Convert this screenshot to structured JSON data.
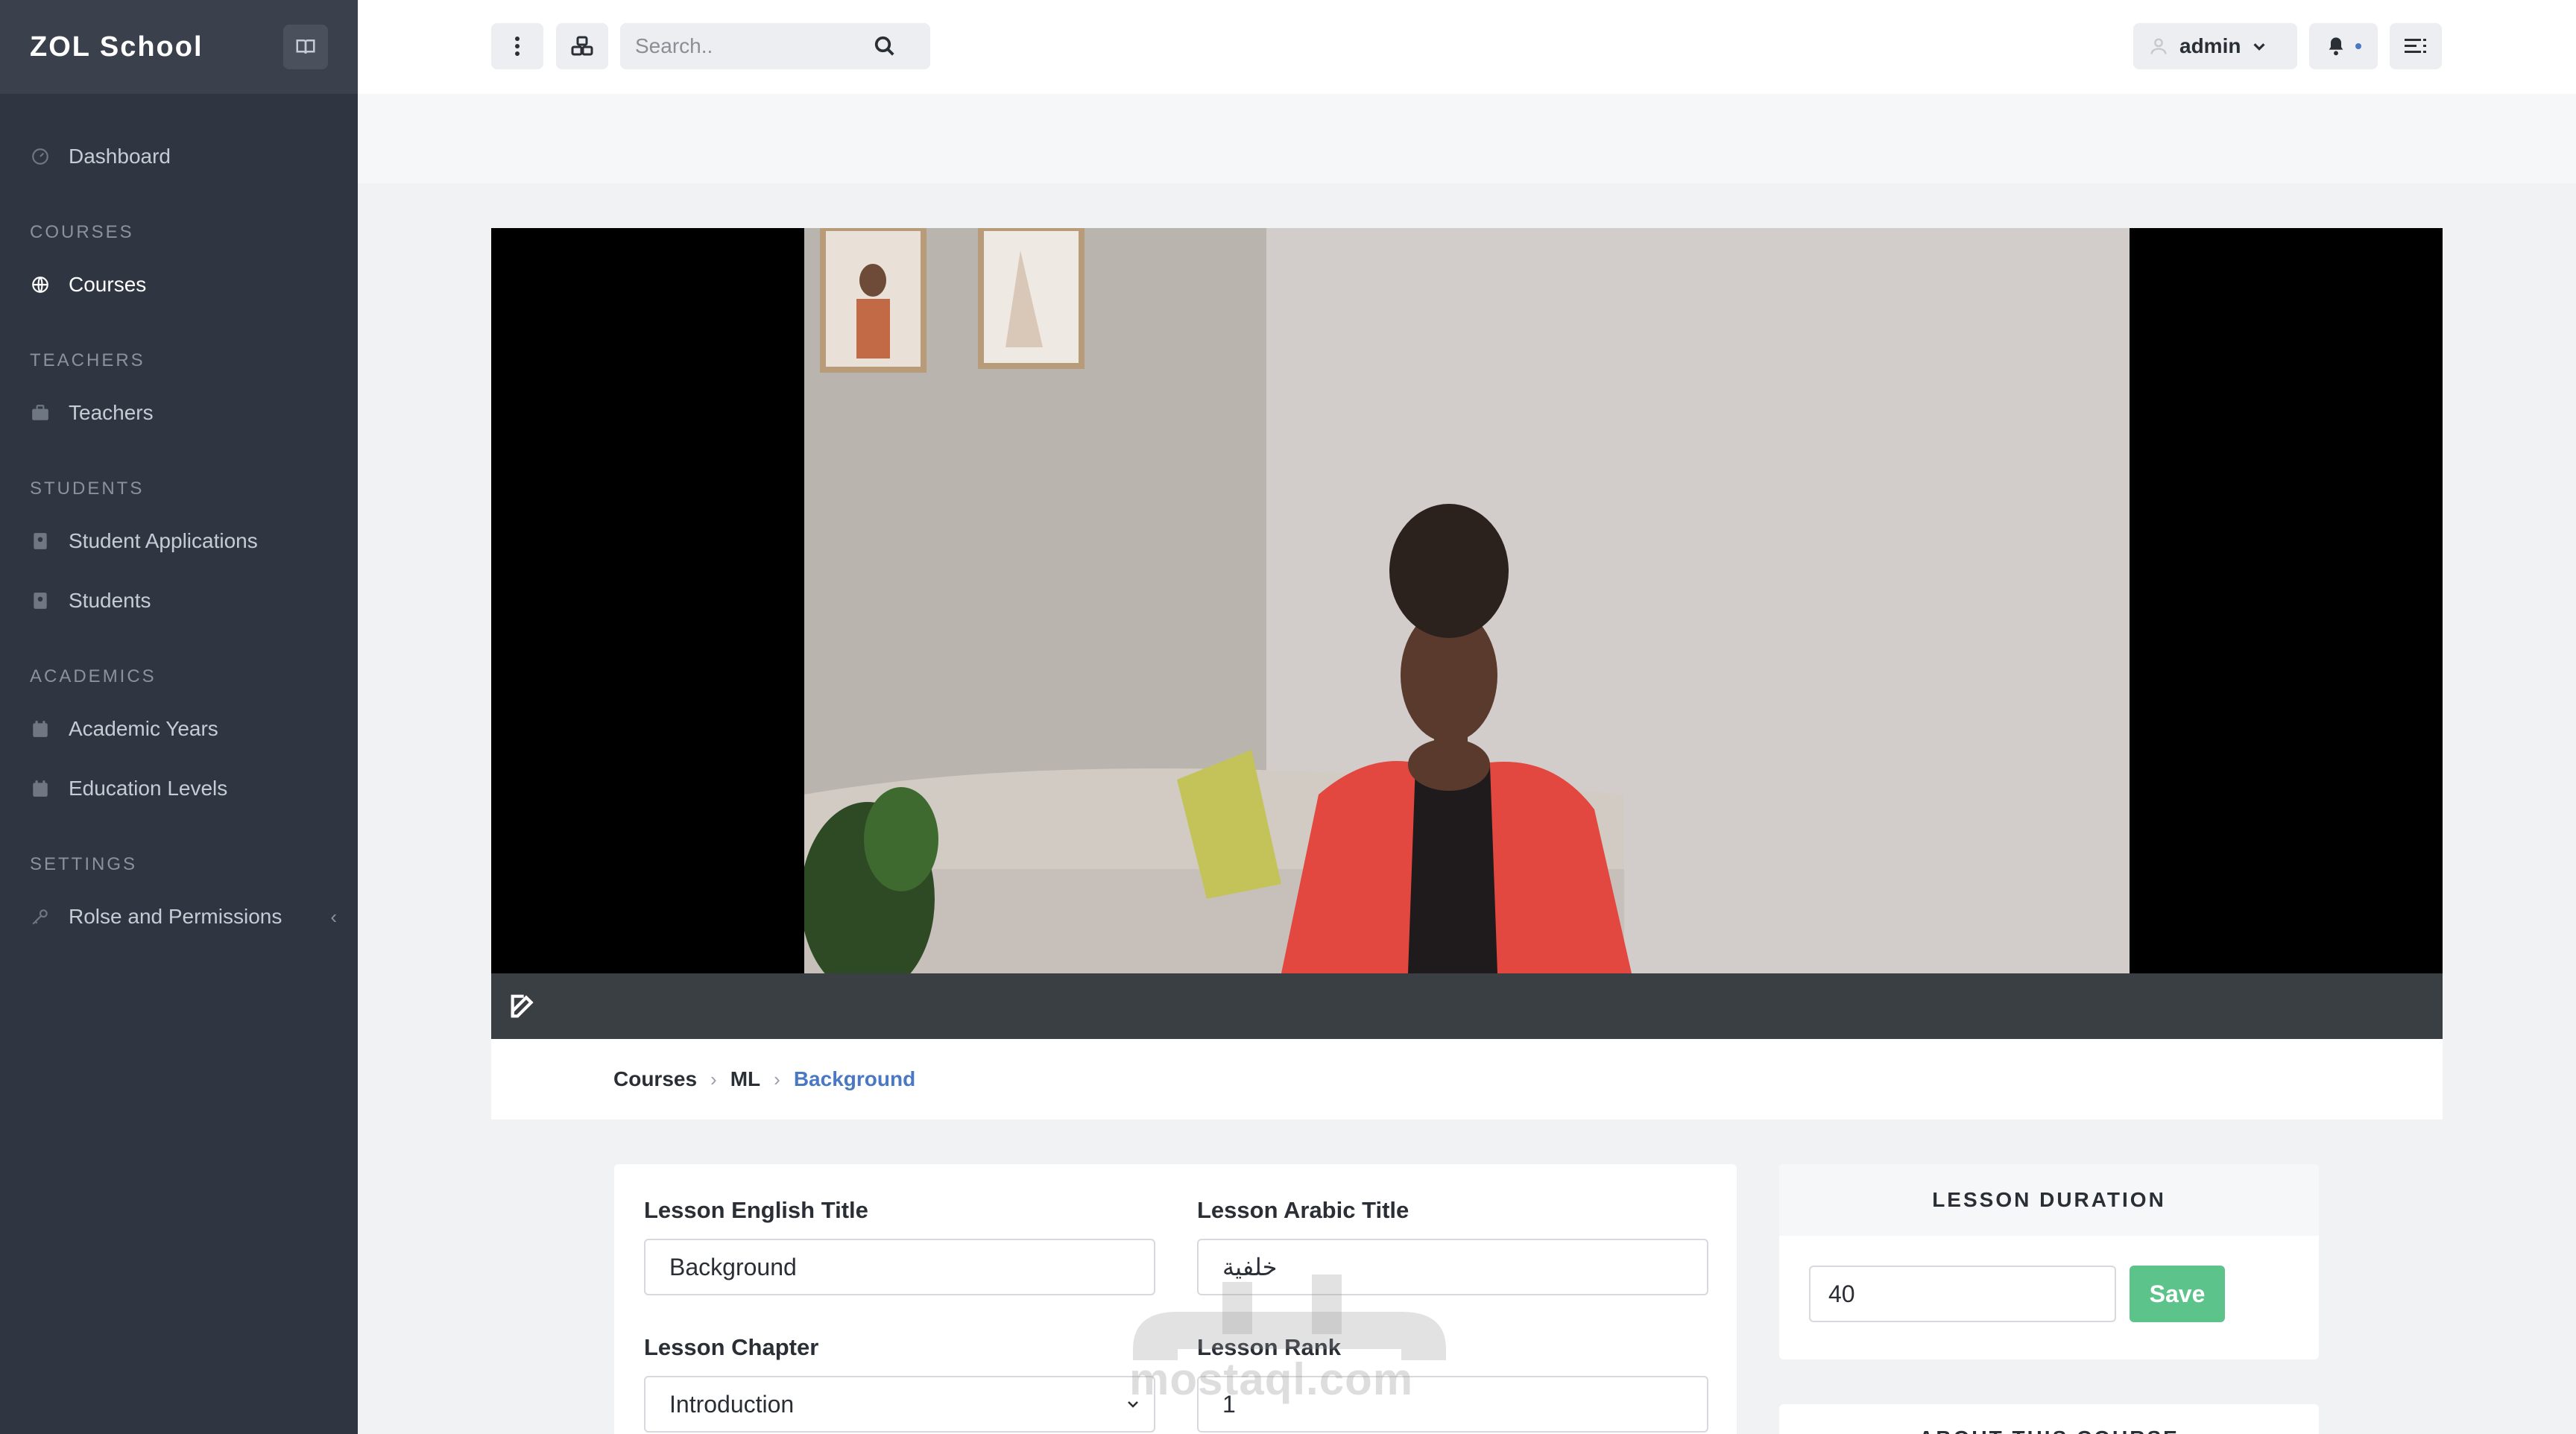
{
  "brand": {
    "title": "ZOL School"
  },
  "sidebar": {
    "dashboard": "Dashboard",
    "sections": [
      {
        "heading": "COURSES",
        "items": [
          "Courses"
        ]
      },
      {
        "heading": "TEACHERS",
        "items": [
          "Teachers"
        ]
      },
      {
        "heading": "STUDENTS",
        "items": [
          "Student Applications",
          "Students"
        ]
      },
      {
        "heading": "ACADEMICS",
        "items": [
          "Academic Years",
          "Education Levels"
        ]
      },
      {
        "heading": "SETTINGS",
        "items": [
          "Rolse and Permissions"
        ]
      }
    ],
    "active": "Courses"
  },
  "topbar": {
    "search_placeholder": "Search..",
    "user": "admin"
  },
  "breadcrumb": {
    "items": [
      "Courses",
      "ML"
    ],
    "current": "Background"
  },
  "form": {
    "english_title_label": "Lesson English Title",
    "english_title_value": "Background",
    "arabic_title_label": "Lesson Arabic Title",
    "arabic_title_value": "خلفية",
    "chapter_label": "Lesson Chapter",
    "chapter_value": "Introduction",
    "rank_label": "Lesson Rank",
    "rank_value": "1"
  },
  "duration": {
    "heading": "LESSON DURATION",
    "value": "40",
    "save_label": "Save"
  },
  "about": {
    "heading": "ABOUT THIS COURSE"
  },
  "watermark": {
    "text": "mostaql.com"
  },
  "colors": {
    "accent": "#4a78c2",
    "save": "#5cc38a",
    "sidebar": "#2f3641"
  }
}
